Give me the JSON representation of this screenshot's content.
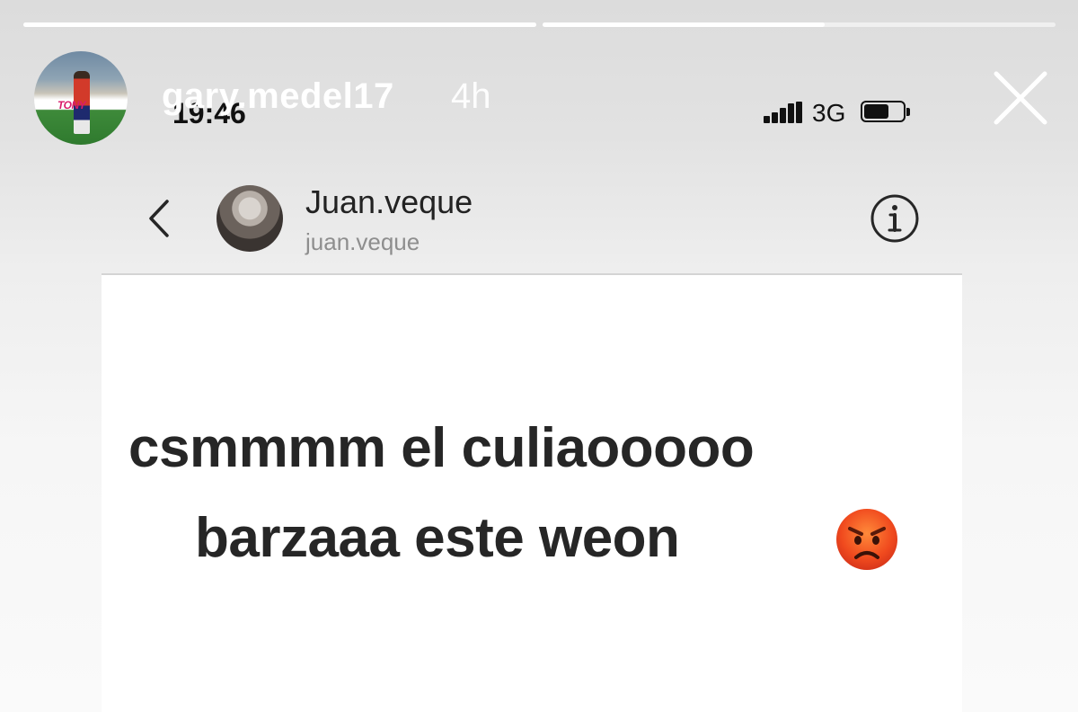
{
  "story": {
    "progress": [
      1.0,
      0.55
    ],
    "username": "gary.medel17",
    "age": "4h",
    "avatar_banner_text": "TONY"
  },
  "status_bar": {
    "time": "19:46",
    "network": "3G",
    "battery_level": 0.65
  },
  "chat_header": {
    "contact_name": "Juan.veque",
    "contact_handle": "juan.veque"
  },
  "message": {
    "line1": "csmmmm el culiaooooo",
    "line2": "barzaaa este weon",
    "emoji": "angry-face"
  },
  "colors": {
    "story_text": "#ffffff",
    "message_text": "#262626",
    "handle_text": "#8e8e8e",
    "emoji_red": "#f04a1e"
  },
  "icons": [
    "close-icon",
    "back-icon",
    "info-icon",
    "signal-icon",
    "battery-icon",
    "angry-face-emoji"
  ]
}
